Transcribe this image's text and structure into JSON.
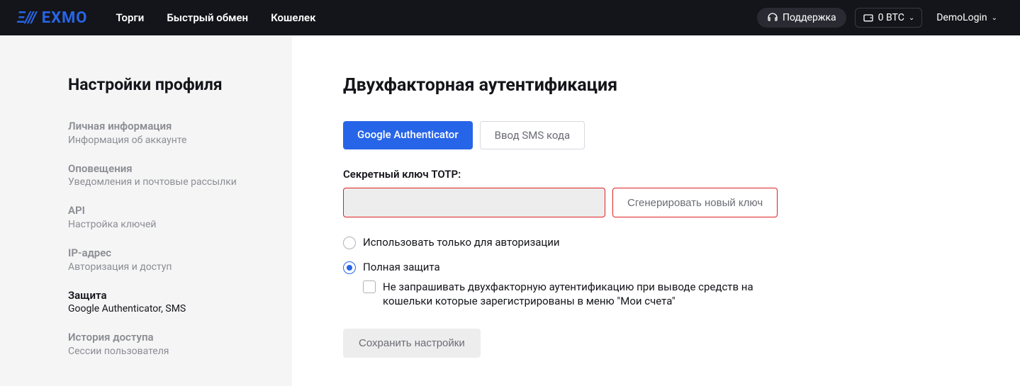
{
  "header": {
    "logo_text": "EXMO",
    "nav": [
      "Торги",
      "Быстрый обмен",
      "Кошелек"
    ],
    "support": "Поддержка",
    "balance": "0 BTC",
    "user": "DemoLogin"
  },
  "sidebar": {
    "title": "Настройки профиля",
    "items": [
      {
        "title": "Личная информация",
        "sub": "Информация об аккаунте",
        "active": false
      },
      {
        "title": "Оповещения",
        "sub": "Уведомления и почтовые рассылки",
        "active": false
      },
      {
        "title": "API",
        "sub": "Настройка ключей",
        "active": false
      },
      {
        "title": "IP-адрес",
        "sub": "Авторизация и доступ",
        "active": false
      },
      {
        "title": "Защита",
        "sub": "Google Authenticator, SMS",
        "active": true
      },
      {
        "title": "История доступа",
        "sub": "Сессии пользователя",
        "active": false
      }
    ]
  },
  "main": {
    "title": "Двухфакторная аутентификация",
    "tabs": [
      {
        "label": "Google Authenticator",
        "active": true
      },
      {
        "label": "Ввод SMS кода",
        "active": false
      }
    ],
    "secret_label": "Секретный ключ TOTP:",
    "secret_value": "",
    "generate_label": "Сгенерировать новый ключ",
    "radio_auth_only": "Использовать только для авторизации",
    "radio_full": "Полная защита",
    "checkbox_skip": "Не запрашивать двухфакторную аутентификацию при выводе средств на кошельки которые зарегистрированы в меню \"Мои счета\"",
    "save_label": "Сохранить настройки"
  }
}
